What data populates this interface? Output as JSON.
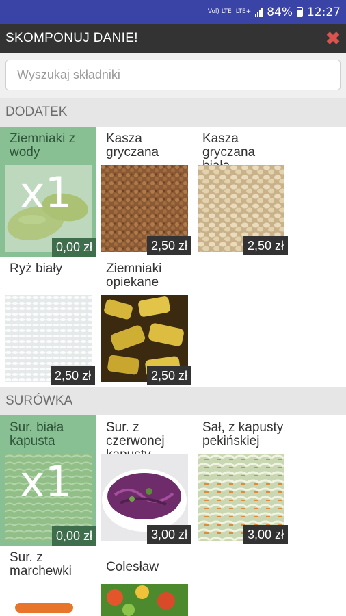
{
  "status_bar": {
    "network_label_top": "Vol) LTE",
    "network_label_bottom": "LTE+",
    "battery": "84%",
    "time": "12:27"
  },
  "app_bar": {
    "title": "SKOMPONUJ DANIE!",
    "close_icon": "close-x-icon",
    "close_color": "#d9534f"
  },
  "search": {
    "placeholder": "Wyszukaj składniki",
    "value": ""
  },
  "sections": [
    {
      "title": "DODATEK",
      "items": [
        {
          "name": "Ziemniaki z wody",
          "price": "0,00 zł",
          "selected": true,
          "qty": "x1",
          "image": "boiled-potatoes"
        },
        {
          "name": "Kasza gryczana",
          "price": "2,50 zł",
          "selected": false,
          "qty": "",
          "image": "buckwheat"
        },
        {
          "name": "Kasza gryczana biała",
          "price": "2,50 zł",
          "selected": false,
          "qty": "",
          "image": "white-buckwheat"
        },
        {
          "name": "Ryż biały",
          "price": "2,50 zł",
          "selected": false,
          "qty": "",
          "image": "white-rice"
        },
        {
          "name": "Ziemniaki opiekane",
          "price": "2,50 zł",
          "selected": false,
          "qty": "",
          "image": "roasted-potatoes"
        }
      ]
    },
    {
      "title": "SURÓWKA",
      "items": [
        {
          "name": "Sur. biała kapusta",
          "price": "0,00 zł",
          "selected": true,
          "qty": "x1",
          "image": "white-cabbage-salad"
        },
        {
          "name": "Sur. z czerwonej kapusty",
          "price": "3,00 zł",
          "selected": false,
          "qty": "",
          "image": "red-cabbage-salad"
        },
        {
          "name": "Sał, z kapusty pekińskiej",
          "price": "3,00 zł",
          "selected": false,
          "qty": "",
          "image": "chinese-cabbage-salad"
        },
        {
          "name": "Sur. z marchewki",
          "price": "",
          "selected": false,
          "qty": "",
          "image": "carrot-salad"
        },
        {
          "name": "Colesław",
          "price": "",
          "selected": false,
          "qty": "",
          "image": "coleslaw"
        }
      ]
    }
  ],
  "colors": {
    "status_bar": "#3a44a6",
    "app_bar": "#333333",
    "selected_tile": "#88bf93",
    "section_header": "#e6e6e6"
  }
}
